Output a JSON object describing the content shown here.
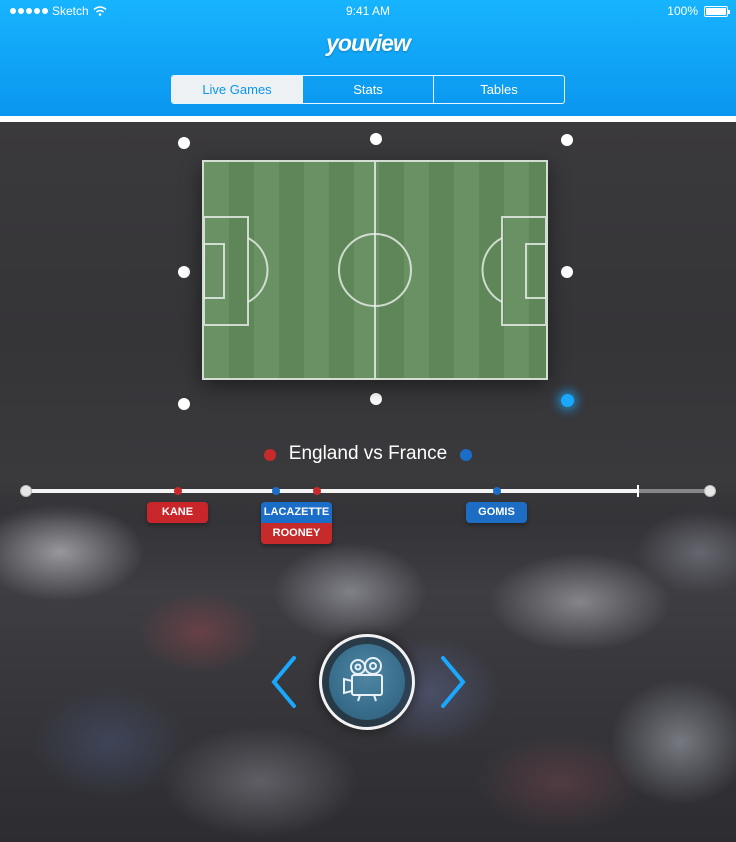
{
  "status_bar": {
    "carrier": "Sketch",
    "time": "9:41 AM",
    "battery": "100%"
  },
  "header": {
    "logo": "youview"
  },
  "tabs": [
    {
      "label": "Live Games",
      "active": true
    },
    {
      "label": "Stats",
      "active": false
    },
    {
      "label": "Tables",
      "active": false
    }
  ],
  "match": {
    "title": "England vs France",
    "home_color": "#c62a2a",
    "away_color": "#1b6ec7"
  },
  "timeline": {
    "progress": 0.895,
    "events": [
      {
        "player": "KANE",
        "team": "home"
      },
      {
        "player": "LACAZETTE",
        "team": "away"
      },
      {
        "player": "ROONEY",
        "team": "home"
      },
      {
        "player": "GOMIS",
        "team": "away"
      }
    ]
  },
  "camera": {
    "icon": "video-camera-icon",
    "prev_icon": "chevron-left-icon",
    "next_icon": "chevron-right-icon"
  },
  "colors": {
    "accent": "#0a96ee",
    "pitch": "#6a9164"
  }
}
